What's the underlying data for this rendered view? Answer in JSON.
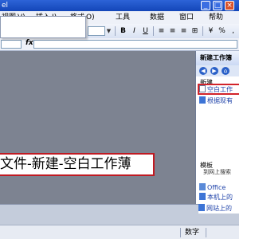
{
  "window": {
    "title": "el",
    "min_label": "_",
    "max_label": "□",
    "close_label": "×"
  },
  "menubar": {
    "items": [
      "视图",
      "V)",
      "插入",
      "I)",
      "格式",
      "O)",
      "工具",
      "数据",
      "窗口",
      "帮助"
    ]
  },
  "formula_bar": {
    "fx_label": "fx"
  },
  "task_pane": {
    "title": "新建工作簿",
    "section_new": "新建",
    "item_blank_workbook": "空白工作",
    "item_from_existing": "根据现有",
    "section_templates": "模板",
    "search_online_label": "到网上搜索",
    "template_office": "Office",
    "template_local": "本机上的",
    "template_website": "网站上的"
  },
  "caption": {
    "text": "文件-新建-空白工作薄"
  },
  "status": {
    "text": "数字"
  }
}
